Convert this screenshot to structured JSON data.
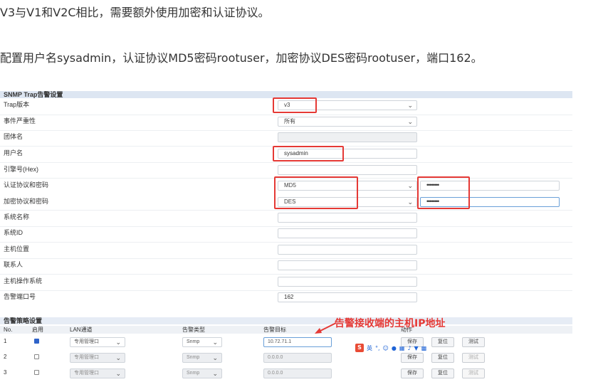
{
  "intro": {
    "line1": "V3与V1和V2C相比，需要额外使用加密和认证协议。",
    "line2": "配置用户名sysadmin，认证协议MD5密码rootuser，加密协议DES密码rootuser，端口162。"
  },
  "snmp_trap": {
    "title": "SNMP Trap告警设置",
    "fields": {
      "trap_version": {
        "label": "Trap版本",
        "value": "v3"
      },
      "severity": {
        "label": "事件严重性",
        "value": "所有"
      },
      "community": {
        "label": "团体名",
        "value": ""
      },
      "username": {
        "label": "用户名",
        "value": "sysadmin"
      },
      "engine_id": {
        "label": "引擎号(Hex)",
        "value": ""
      },
      "auth": {
        "label": "认证协议和密码",
        "value": "MD5",
        "password": "••••••••"
      },
      "privacy": {
        "label": "加密协议和密码",
        "value": "DES",
        "password": "••••••••"
      },
      "sys_name": {
        "label": "系统名称",
        "value": ""
      },
      "sys_id": {
        "label": "系统ID",
        "value": ""
      },
      "host_location": {
        "label": "主机位置",
        "value": ""
      },
      "contact": {
        "label": "联系人",
        "value": ""
      },
      "host_os": {
        "label": "主机操作系统",
        "value": ""
      },
      "alarm_port": {
        "label": "告警端口号",
        "value": "162"
      }
    }
  },
  "policy": {
    "title": "告警策略设置",
    "headers": {
      "no": "No.",
      "enable": "启用",
      "lan": "LAN通道",
      "type": "告警类型",
      "target": "告警目标",
      "action": "动作"
    },
    "rows": [
      {
        "no": "1",
        "enabled": true,
        "lan": "专用管理口",
        "type": "Snmp",
        "target": "10.72.71.1"
      },
      {
        "no": "2",
        "enabled": false,
        "lan": "专用管理口",
        "type": "Snmp",
        "target": "0.0.0.0"
      },
      {
        "no": "3",
        "enabled": false,
        "lan": "专用管理口",
        "type": "Snmp",
        "target": "0.0.0.0"
      }
    ],
    "buttons": {
      "save": "保存",
      "reset": "复位",
      "test": "测试"
    }
  },
  "annotation": {
    "text": "告警接收端的主机IP地址"
  },
  "ime": {
    "logo": "S",
    "lang": "英"
  },
  "colors": {
    "highlight": "#e53935",
    "header_bg": "#dde6f2",
    "checkbox": "#2f63c9"
  }
}
